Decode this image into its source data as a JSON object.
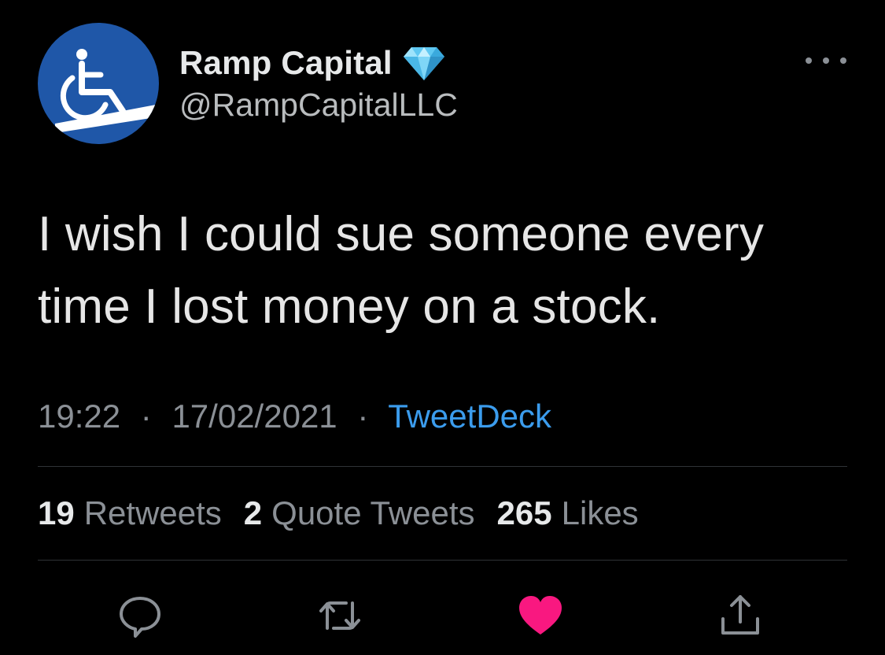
{
  "tweet": {
    "display_name": "Ramp Capital",
    "handle": "@RampCapitalLLC",
    "verified_badge_icon": "diamond-icon",
    "avatar_icon": "wheelchair-ramp-icon",
    "text_line1": "I wish I could sue someone every",
    "text_line2": "time I lost money on a stock.",
    "time": "19:22",
    "separator": "·",
    "date": "17/02/2021",
    "source": "TweetDeck"
  },
  "stats": {
    "retweets_count": "19",
    "retweets_label": "Retweets",
    "quotes_count": "2",
    "quotes_label": "Quote Tweets",
    "likes_count": "265",
    "likes_label": "Likes"
  },
  "actions": {
    "reply_icon": "reply-icon",
    "retweet_icon": "retweet-icon",
    "like_icon": "heart-icon",
    "share_icon": "share-icon"
  },
  "colors": {
    "background": "#000000",
    "accent_link": "#3b9ced",
    "like_red": "#f91880",
    "muted_text": "#8b9096",
    "avatar_blue": "#1f57a8"
  }
}
